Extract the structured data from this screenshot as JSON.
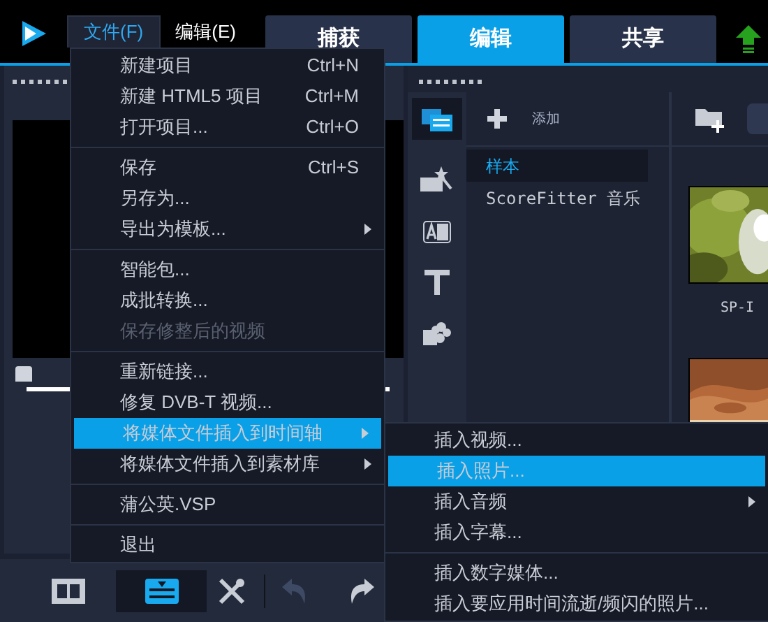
{
  "menu_bar": [
    {
      "label": "文件(F)",
      "selected": true
    },
    {
      "label": "编辑(E)",
      "selected": false
    }
  ],
  "tabs": [
    {
      "label": "捕获",
      "selected": false
    },
    {
      "label": "编辑",
      "selected": true
    },
    {
      "label": "共享",
      "selected": false
    }
  ],
  "file_menu": [
    {
      "kind": "item",
      "label": "新建项目",
      "shortcut": "Ctrl+N"
    },
    {
      "kind": "item",
      "label": "新建 HTML5 项目",
      "shortcut": "Ctrl+M"
    },
    {
      "kind": "item",
      "label": "打开项目...",
      "shortcut": "Ctrl+O"
    },
    {
      "kind": "separator"
    },
    {
      "kind": "item",
      "label": "保存",
      "shortcut": "Ctrl+S"
    },
    {
      "kind": "item",
      "label": "另存为..."
    },
    {
      "kind": "item",
      "label": "导出为模板...",
      "submenu": true
    },
    {
      "kind": "separator"
    },
    {
      "kind": "item",
      "label": "智能包..."
    },
    {
      "kind": "item",
      "label": "成批转换..."
    },
    {
      "kind": "item",
      "label": "保存修整后的视频",
      "disabled": true
    },
    {
      "kind": "separator"
    },
    {
      "kind": "item",
      "label": "重新链接..."
    },
    {
      "kind": "item",
      "label": "修复 DVB-T 视频..."
    },
    {
      "kind": "item",
      "label": "将媒体文件插入到时间轴",
      "submenu": true,
      "selected": true
    },
    {
      "kind": "item",
      "label": "将媒体文件插入到素材库",
      "submenu": true
    },
    {
      "kind": "separator"
    },
    {
      "kind": "item",
      "label": "蒲公英.VSP"
    },
    {
      "kind": "separator"
    },
    {
      "kind": "item",
      "label": "退出"
    }
  ],
  "submenu": [
    {
      "kind": "item",
      "label": "插入视频..."
    },
    {
      "kind": "item",
      "label": "插入照片...",
      "selected": true
    },
    {
      "kind": "item",
      "label": "插入音频",
      "submenu": true
    },
    {
      "kind": "item",
      "label": "插入字幕..."
    },
    {
      "kind": "separator"
    },
    {
      "kind": "item",
      "label": "插入数字媒体..."
    },
    {
      "kind": "item",
      "label": "插入要应用时间流逝/频闪的照片..."
    }
  ],
  "library": {
    "add_label": "添加",
    "folders": [
      {
        "label": "样本",
        "selected": true
      },
      {
        "label": "ScoreFitter 音乐",
        "selected": false
      }
    ],
    "thumbnails": [
      {
        "kind": "picture",
        "caption": "SP-I"
      },
      {
        "kind": "picture"
      }
    ]
  }
}
